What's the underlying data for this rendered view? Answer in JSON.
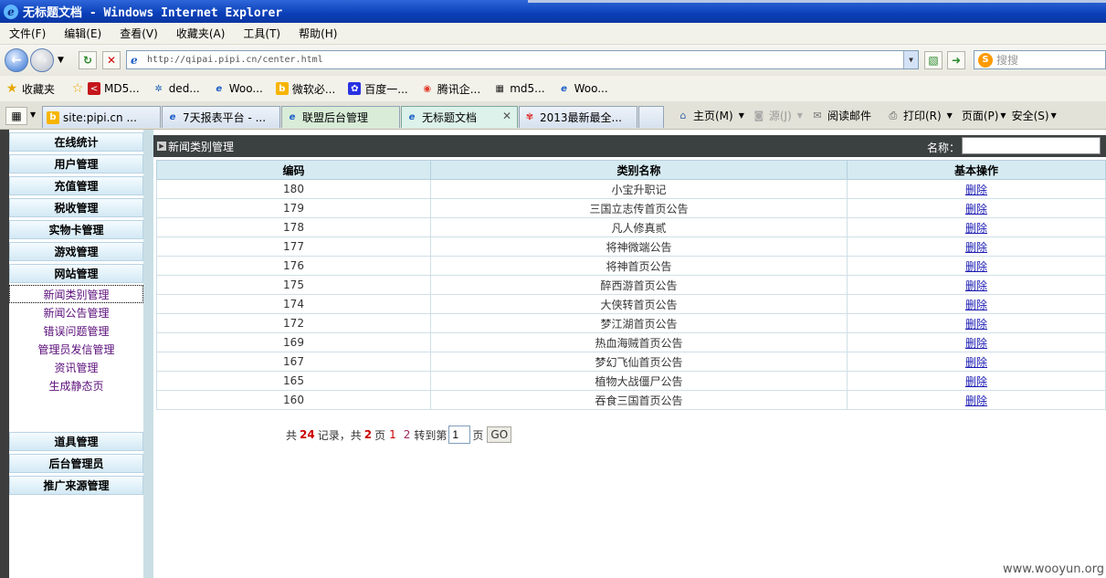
{
  "window": {
    "title": "无标题文档 - Windows Internet Explorer"
  },
  "menu": [
    "文件(F)",
    "编辑(E)",
    "查看(V)",
    "收藏夹(A)",
    "工具(T)",
    "帮助(H)"
  ],
  "address": {
    "url": "http://qipai.pipi.cn/center.html",
    "search_placeholder": "搜搜"
  },
  "favorites": {
    "label": "收藏夹",
    "items": [
      "MD5...",
      "ded...",
      "Woo...",
      "微软必...",
      "百度一...",
      "腾讯企...",
      "md5...",
      "Woo..."
    ]
  },
  "tabs": [
    "site:pipi.cn ...",
    "7天报表平台 - ...",
    "联盟后台管理",
    "无标题文档",
    "2013最新最全..."
  ],
  "commands": [
    "主页(M)",
    "源(J)",
    "阅读邮件",
    "打印(R)",
    "页面(P)",
    "安全(S)"
  ],
  "sidebar": {
    "top": [
      "在线统计",
      "用户管理",
      "充值管理",
      "税收管理",
      "实物卡管理",
      "游戏管理",
      "网站管理"
    ],
    "sub": [
      "新闻类别管理",
      "新闻公告管理",
      "错误问题管理",
      "管理员发信管理",
      "资讯管理",
      "生成静态页"
    ],
    "bottom": [
      "道具管理",
      "后台管理员",
      "推广来源管理"
    ]
  },
  "main": {
    "title": "新闻类别管理",
    "name_label": "名称：",
    "columns": [
      "编码",
      "类别名称",
      "基本操作"
    ],
    "rows": [
      {
        "id": "180",
        "name": "小宝升职记",
        "op": "删除"
      },
      {
        "id": "179",
        "name": "三国立志传首页公告",
        "op": "删除"
      },
      {
        "id": "178",
        "name": "凡人修真贰",
        "op": "删除"
      },
      {
        "id": "177",
        "name": "将神微端公告",
        "op": "删除"
      },
      {
        "id": "176",
        "name": "将神首页公告",
        "op": "删除"
      },
      {
        "id": "175",
        "name": "醉西游首页公告",
        "op": "删除"
      },
      {
        "id": "174",
        "name": "大侠转首页公告",
        "op": "删除"
      },
      {
        "id": "172",
        "name": "梦江湖首页公告",
        "op": "删除"
      },
      {
        "id": "169",
        "name": "热血海贼首页公告",
        "op": "删除"
      },
      {
        "id": "167",
        "name": "梦幻飞仙首页公告",
        "op": "删除"
      },
      {
        "id": "165",
        "name": "植物大战僵尸公告",
        "op": "删除"
      },
      {
        "id": "160",
        "name": "吞食三国首页公告",
        "op": "删除"
      }
    ],
    "pager": {
      "p1": "共",
      "total": "24",
      "p2": "记录，共",
      "pages": "2",
      "p3": "页",
      "page1": "1",
      "page2": "2",
      "goto": "转到第",
      "input": "1",
      "p4": "页",
      "go": "GO"
    }
  },
  "watermark": "www.wooyun.org"
}
